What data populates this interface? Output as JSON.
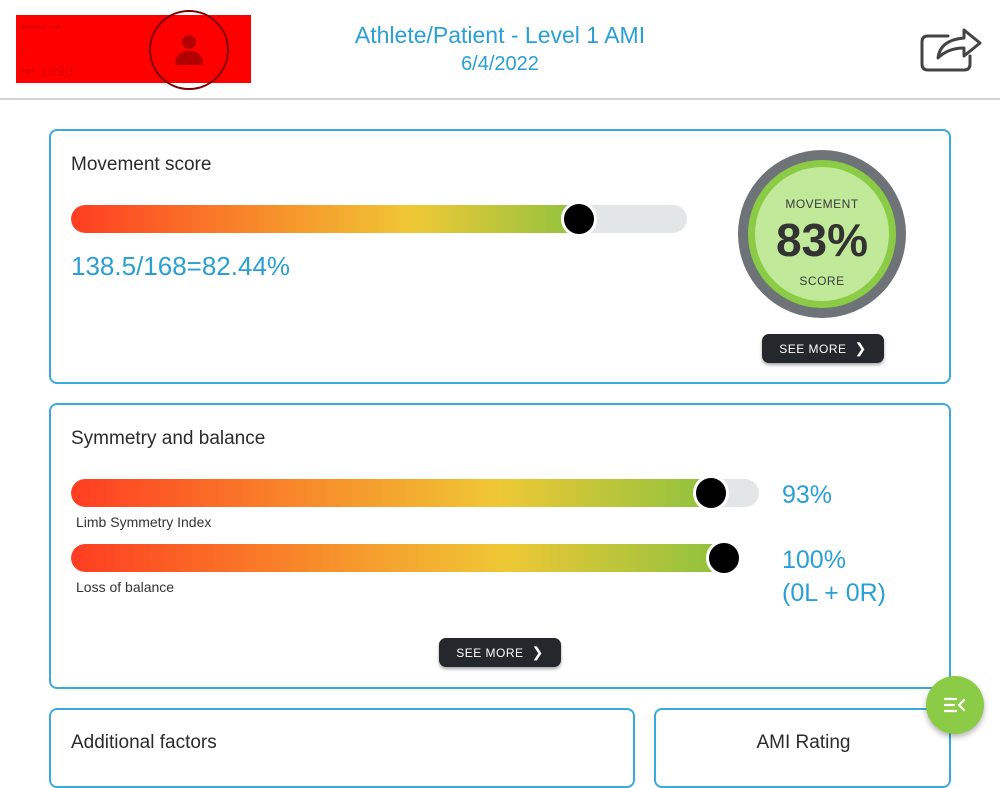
{
  "header": {
    "title": "Athlete/Patient - Level 1 AMI",
    "date": "6/4/2022",
    "redacted_lines": [
      "••••• ••",
      "•",
      "••• 1990"
    ]
  },
  "movement": {
    "title": "Movement score",
    "formula": "138.5/168=82.44%",
    "progress": 0.8244,
    "gauge_label_top": "MOVEMENT",
    "gauge_value": "83%",
    "gauge_label_bottom": "SCORE",
    "see_more": "SEE MORE"
  },
  "symmetry": {
    "title": "Symmetry and balance",
    "limb_label": "Limb Symmetry Index",
    "limb_value": "93%",
    "limb_progress": 0.93,
    "balance_label": "Loss of balance",
    "balance_value": "100%",
    "balance_detail": "(0L + 0R)",
    "balance_progress": 1.0,
    "see_more": "SEE MORE"
  },
  "additional": {
    "title": "Additional factors"
  },
  "ami_rating": {
    "title": "AMI Rating"
  },
  "colors": {
    "accent": "#2a9fd6",
    "card_border": "#3ba9dd",
    "fab": "#8ccb45"
  }
}
